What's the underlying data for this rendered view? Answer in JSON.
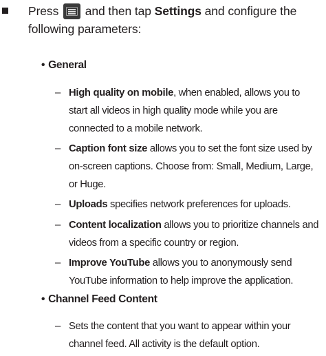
{
  "intro": {
    "prefix": "Press",
    "icon": "menu-key-icon",
    "middle": "and then tap",
    "settings_word": "Settings",
    "suffix": "and configure the following parameters:"
  },
  "general": {
    "heading": "General",
    "items": [
      {
        "term": "High quality on mobile",
        "desc": ", when enabled, allows you to start all videos in high quality mode while you are connected to a mobile network."
      },
      {
        "term": "Caption font size",
        "desc": " allows you to set the font size used by on-screen captions. Choose from: Small, Medium, Large, or Huge."
      },
      {
        "term": "Uploads",
        "desc": " specifies network preferences for uploads."
      },
      {
        "term": "Content localization",
        "desc": " allows you to prioritize channels and videos from a specific country or region."
      },
      {
        "term": "Improve YouTube",
        "desc": " allows you to anonymously send YouTube information to help improve the application."
      }
    ]
  },
  "channel_feed": {
    "heading": "Channel Feed Content",
    "items": [
      {
        "desc": "Sets the content that you want to appear within your channel feed. All activity is the default option."
      }
    ]
  }
}
